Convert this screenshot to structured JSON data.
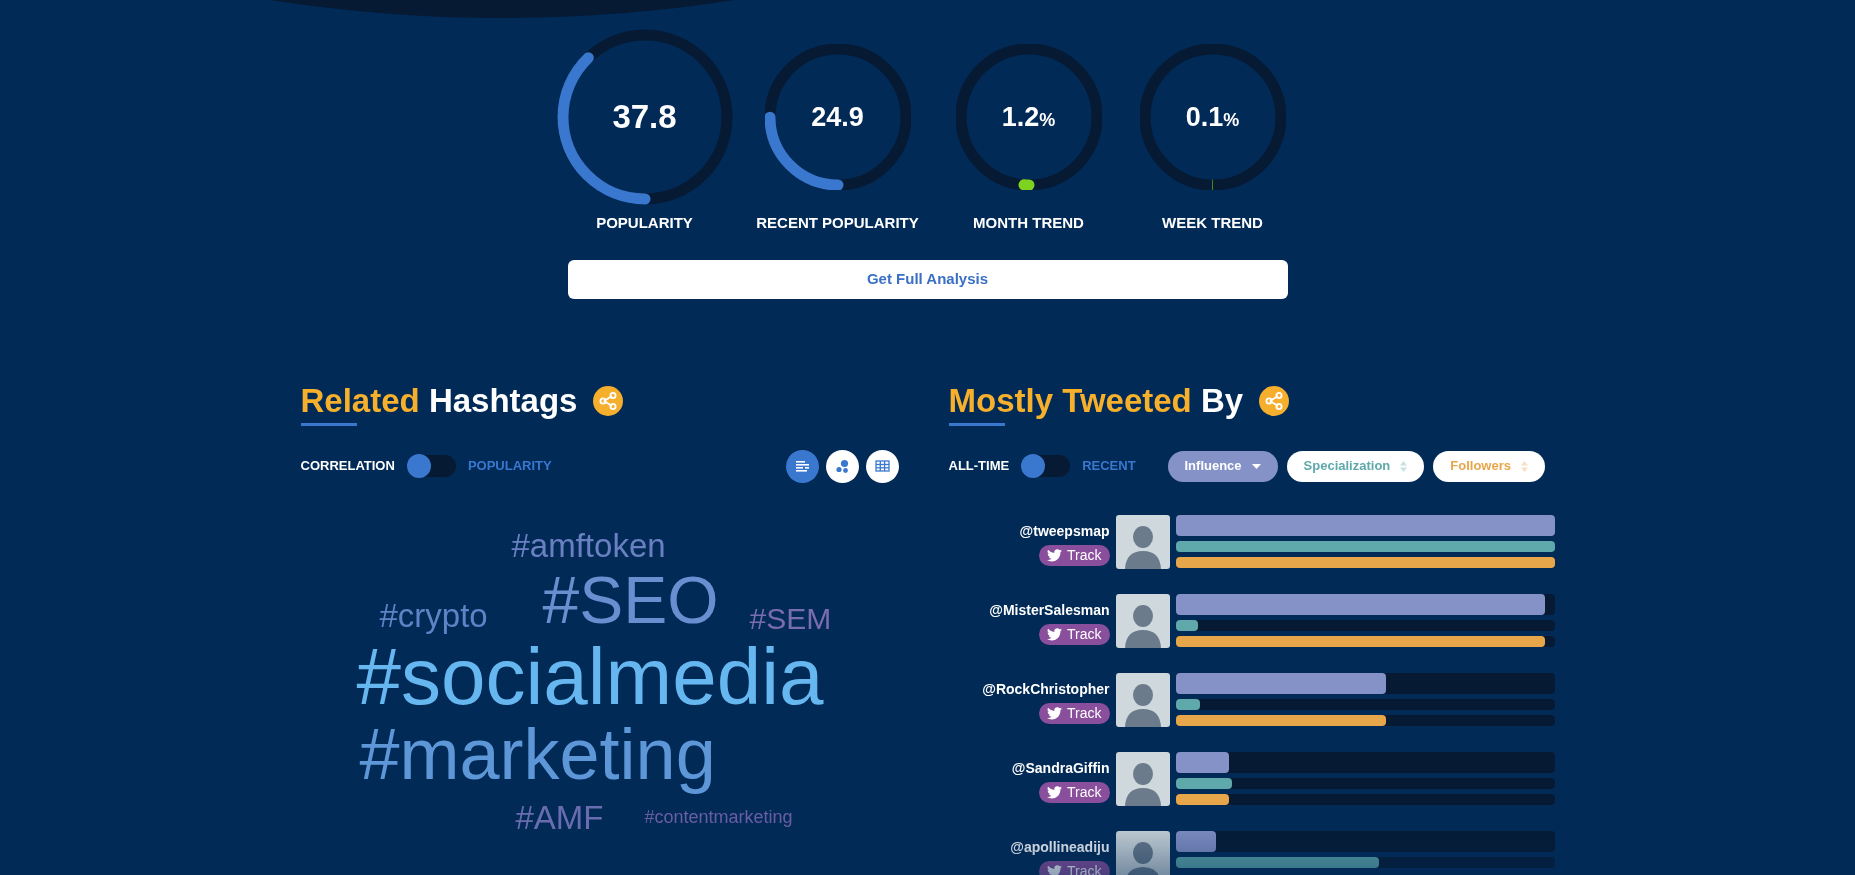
{
  "gauges": [
    {
      "value": "37.8",
      "label": "POPULARITY",
      "level": 0.378,
      "color": "#3a78d0"
    },
    {
      "value": "24.9",
      "label": "RECENT POPULARITY",
      "level": 0.249,
      "color": "#3a78d0"
    },
    {
      "value": "1.2",
      "unit": "%",
      "label": "MONTH TREND",
      "level": 0.012,
      "color": "#7ed321"
    },
    {
      "value": "0.1",
      "unit": "%",
      "label": "WEEK TREND",
      "level": 0.001,
      "color": "#4a8a1c"
    }
  ],
  "analysis_button": "Get Full Analysis",
  "related_hashtags": {
    "title_highlight": "Related",
    "title_rest": "Hashtags",
    "toggle": [
      {
        "label": "CORRELATION",
        "selected": true
      },
      {
        "label": "POPULARITY",
        "selected": false
      }
    ],
    "views": [
      {
        "kind": "list",
        "selected": true
      },
      {
        "kind": "bubbles",
        "selected": false
      },
      {
        "kind": "table",
        "selected": false
      }
    ],
    "words": [
      {
        "text": "#amftoken",
        "color": "#6b80c2"
      },
      {
        "text": "#crypto",
        "color": "#5f84c6"
      },
      {
        "text": "#SEO",
        "color": "#6a8fd0"
      },
      {
        "text": "#SEM",
        "color": "#7a6cb0"
      },
      {
        "text": "#socialmedia",
        "color": "#66b6f0"
      },
      {
        "text": "#marketing",
        "color": "#5e97d8"
      },
      {
        "text": "#AMF",
        "color": "#6a6cb0"
      },
      {
        "text": "#contentmarketing",
        "color": "#6a5ea2"
      }
    ]
  },
  "mostly_tweeted_by": {
    "title_highlight": "Mostly Tweeted",
    "title_rest": "By",
    "toggle": [
      {
        "label": "ALL-TIME",
        "selected": true
      },
      {
        "label": "RECENT",
        "selected": false
      }
    ],
    "sort": [
      {
        "label": "Influence",
        "selected": true,
        "color": "#8592c8"
      },
      {
        "label": "Specialization",
        "selected": false,
        "color": "#5fa8ab"
      },
      {
        "label": "Followers",
        "selected": false,
        "color": "#e8a64a"
      }
    ],
    "users": [
      {
        "handle": "@tweepsmap",
        "button": "Track",
        "bars": [
          {
            "level": 1
          },
          {
            "level": 1
          },
          {
            "level": 1
          }
        ]
      },
      {
        "handle": "@MisterSalesman",
        "button": "Track",
        "bars": [
          {
            "level": 0.975
          },
          {
            "level": 0.06
          },
          {
            "level": 0.975
          }
        ]
      },
      {
        "handle": "@RockChristopher",
        "button": "Track",
        "bars": [
          {
            "level": 0.555
          },
          {
            "level": 0.065
          },
          {
            "level": 0.555
          }
        ]
      },
      {
        "handle": "@SandraGiffin",
        "button": "Track",
        "bars": [
          {
            "level": 0.14
          },
          {
            "level": 0.148
          },
          {
            "level": 0.14
          }
        ]
      },
      {
        "handle": "@apollineadiju",
        "button": "Track",
        "bars": [
          {
            "level": 0.108
          },
          {
            "level": 0.538
          }
        ]
      }
    ]
  }
}
